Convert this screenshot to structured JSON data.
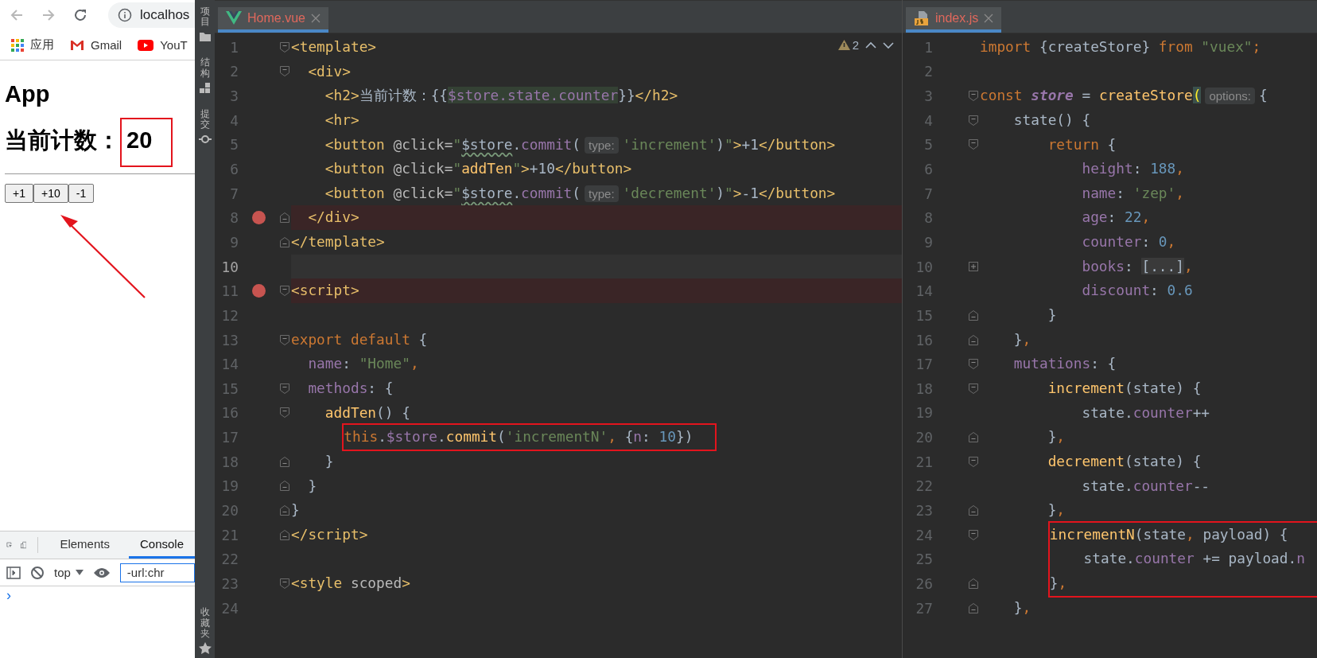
{
  "browser": {
    "address": "localhos",
    "bookmarks": [
      {
        "label": "应用"
      },
      {
        "label": "Gmail"
      },
      {
        "label": "YouT"
      }
    ],
    "page": {
      "title": "App",
      "counter_label": "当前计数：",
      "counter_value": "20",
      "counter_boxed": true,
      "buttons": [
        "+1",
        "+10",
        "-1"
      ],
      "arrow": true
    },
    "devtools": {
      "tabs": [
        {
          "label": "Elements",
          "selected": false
        },
        {
          "label": "Console",
          "selected": true
        }
      ],
      "context": "top",
      "filter": "-url:chr",
      "prompt": "›"
    }
  },
  "tool_strip": {
    "top_items": [
      {
        "label": "项目"
      },
      {
        "label": "结构"
      },
      {
        "label": "提交"
      }
    ],
    "bottom_items": [
      {
        "label": "收藏夹"
      }
    ]
  },
  "editors": [
    {
      "tab": {
        "label": "Home.vue",
        "kind": "vue",
        "selected": true
      },
      "warnings": "2",
      "lines": [
        {
          "number": "1",
          "fold": {
            "kind": "open"
          },
          "breakpoint": false,
          "current": false,
          "boxed": false,
          "tokens": [
            {
              "text": "<template>",
              "kind": "tag"
            }
          ]
        },
        {
          "number": "2",
          "fold": {
            "kind": "open"
          },
          "breakpoint": false,
          "current": false,
          "boxed": false,
          "tokens": [
            {
              "text": "  <div>",
              "kind": "tag"
            }
          ]
        },
        {
          "number": "3",
          "breakpoint": false,
          "current": false,
          "boxed": false,
          "tokens": [
            {
              "text": "    <h2>",
              "kind": "tag"
            },
            {
              "text": "当前计数：{{",
              "kind": "plain"
            },
            {
              "text": "$store.state.counter",
              "kind": "interp"
            },
            {
              "text": "}}",
              "kind": "plain"
            },
            {
              "text": "</h2>",
              "kind": "tag"
            }
          ]
        },
        {
          "number": "4",
          "breakpoint": false,
          "current": false,
          "boxed": false,
          "tokens": [
            {
              "text": "    <hr>",
              "kind": "tag"
            }
          ]
        },
        {
          "number": "5",
          "breakpoint": false,
          "current": false,
          "boxed": false,
          "tokens": [
            {
              "text": "    <button",
              "kind": "tag"
            },
            {
              "text": " @click=",
              "kind": "attr"
            },
            {
              "text": "\"",
              "kind": "string"
            },
            {
              "text": "$store",
              "kind": "warn"
            },
            {
              "text": ".",
              "kind": "plain"
            },
            {
              "text": "commit",
              "kind": "prop"
            },
            {
              "text": "(",
              "kind": "plain"
            },
            {
              "text": "type:",
              "kind": "hint"
            },
            {
              "text": "'increment'",
              "kind": "string"
            },
            {
              "text": ")",
              "kind": "plain"
            },
            {
              "text": "\"",
              "kind": "string"
            },
            {
              "text": ">",
              "kind": "tag"
            },
            {
              "text": "+1",
              "kind": "plain"
            },
            {
              "text": "</button>",
              "kind": "tag"
            }
          ]
        },
        {
          "number": "6",
          "breakpoint": false,
          "current": false,
          "boxed": false,
          "tokens": [
            {
              "text": "    <button",
              "kind": "tag"
            },
            {
              "text": " @click=",
              "kind": "attr"
            },
            {
              "text": "\"",
              "kind": "string"
            },
            {
              "text": "addTen",
              "kind": "fn"
            },
            {
              "text": "\"",
              "kind": "string"
            },
            {
              "text": ">",
              "kind": "tag"
            },
            {
              "text": "+10",
              "kind": "plain"
            },
            {
              "text": "</button>",
              "kind": "tag"
            }
          ]
        },
        {
          "number": "7",
          "breakpoint": false,
          "current": false,
          "boxed": false,
          "tokens": [
            {
              "text": "    <button",
              "kind": "tag"
            },
            {
              "text": " @click=",
              "kind": "attr"
            },
            {
              "text": "\"",
              "kind": "string"
            },
            {
              "text": "$store",
              "kind": "warn"
            },
            {
              "text": ".",
              "kind": "plain"
            },
            {
              "text": "commit",
              "kind": "prop"
            },
            {
              "text": "(",
              "kind": "plain"
            },
            {
              "text": "type:",
              "kind": "hint"
            },
            {
              "text": "'decrement'",
              "kind": "string"
            },
            {
              "text": ")",
              "kind": "plain"
            },
            {
              "text": "\"",
              "kind": "string"
            },
            {
              "text": ">",
              "kind": "tag"
            },
            {
              "text": "-1",
              "kind": "plain"
            },
            {
              "text": "</button>",
              "kind": "tag"
            }
          ]
        },
        {
          "number": "8",
          "fold": {
            "kind": "close"
          },
          "breakpoint": true,
          "current": false,
          "boxed": false,
          "tokens": [
            {
              "text": "  </div>",
              "kind": "tag"
            }
          ]
        },
        {
          "number": "9",
          "fold": {
            "kind": "close"
          },
          "breakpoint": false,
          "current": false,
          "boxed": false,
          "tokens": [
            {
              "text": "</template>",
              "kind": "tag"
            }
          ]
        },
        {
          "number": "10",
          "breakpoint": false,
          "current": true,
          "boxed": false
        },
        {
          "number": "11",
          "fold": {
            "kind": "open"
          },
          "breakpoint": true,
          "current": false,
          "boxed": false,
          "tokens": [
            {
              "text": "<script>",
              "kind": "tag"
            }
          ]
        },
        {
          "number": "12",
          "breakpoint": false,
          "current": false,
          "boxed": false
        },
        {
          "number": "13",
          "fold": {
            "kind": "open"
          },
          "breakpoint": false,
          "current": false,
          "boxed": false,
          "tokens": [
            {
              "text": "export default",
              "kind": "keyword"
            },
            {
              "text": " {",
              "kind": "plain"
            }
          ]
        },
        {
          "number": "14",
          "breakpoint": false,
          "current": false,
          "boxed": false,
          "tokens": [
            {
              "text": "  name",
              "kind": "prop"
            },
            {
              "text": ": ",
              "kind": "plain"
            },
            {
              "text": "\"Home\"",
              "kind": "string"
            },
            {
              "text": ",",
              "kind": "keyword"
            }
          ]
        },
        {
          "number": "15",
          "fold": {
            "kind": "open"
          },
          "breakpoint": false,
          "current": false,
          "boxed": false,
          "tokens": [
            {
              "text": "  methods",
              "kind": "prop"
            },
            {
              "text": ": {",
              "kind": "plain"
            }
          ]
        },
        {
          "number": "16",
          "fold": {
            "kind": "open"
          },
          "breakpoint": false,
          "current": false,
          "boxed": false,
          "tokens": [
            {
              "text": "    addTen",
              "kind": "fn"
            },
            {
              "text": "() {",
              "kind": "plain"
            }
          ]
        },
        {
          "number": "17",
          "breakpoint": false,
          "current": false,
          "boxed": true,
          "tokens": [
            {
              "text": "      this",
              "kind": "keyword"
            },
            {
              "text": ".",
              "kind": "plain"
            },
            {
              "text": "$store",
              "kind": "prop"
            },
            {
              "text": ".",
              "kind": "plain"
            },
            {
              "text": "commit",
              "kind": "fn"
            },
            {
              "text": "(",
              "kind": "plain"
            },
            {
              "text": "'incrementN'",
              "kind": "string"
            },
            {
              "text": ",",
              "kind": "keyword"
            },
            {
              "text": " {",
              "kind": "plain"
            },
            {
              "text": "n",
              "kind": "prop"
            },
            {
              "text": ": ",
              "kind": "plain"
            },
            {
              "text": "10",
              "kind": "number"
            },
            {
              "text": "})",
              "kind": "plain"
            }
          ]
        },
        {
          "number": "18",
          "fold": {
            "kind": "close"
          },
          "breakpoint": false,
          "current": false,
          "boxed": false,
          "tokens": [
            {
              "text": "    }",
              "kind": "plain"
            }
          ]
        },
        {
          "number": "19",
          "fold": {
            "kind": "close"
          },
          "breakpoint": false,
          "current": false,
          "boxed": false,
          "tokens": [
            {
              "text": "  }",
              "kind": "plain"
            }
          ]
        },
        {
          "number": "20",
          "fold": {
            "kind": "close"
          },
          "breakpoint": false,
          "current": false,
          "boxed": false,
          "tokens": [
            {
              "text": "}",
              "kind": "plain"
            }
          ]
        },
        {
          "number": "21",
          "fold": {
            "kind": "close"
          },
          "breakpoint": false,
          "current": false,
          "boxed": false,
          "tokens": [
            {
              "text": "</script>",
              "kind": "tag"
            }
          ]
        },
        {
          "number": "22",
          "breakpoint": false,
          "current": false,
          "boxed": false
        },
        {
          "number": "23",
          "fold": {
            "kind": "open"
          },
          "breakpoint": false,
          "current": false,
          "boxed": false,
          "tokens": [
            {
              "text": "<style",
              "kind": "tag"
            },
            {
              "text": " scoped",
              "kind": "attr"
            },
            {
              "text": ">",
              "kind": "tag"
            }
          ]
        },
        {
          "number": "24",
          "breakpoint": false,
          "current": false,
          "boxed": false
        }
      ]
    },
    {
      "tab": {
        "label": "index.js",
        "kind": "js",
        "selected": true
      },
      "lines": [
        {
          "number": "1",
          "breakpoint": false,
          "current": false,
          "boxed": false,
          "tokens": [
            {
              "text": "import ",
              "kind": "keyword"
            },
            {
              "text": "{createStore} ",
              "kind": "plain"
            },
            {
              "text": "from ",
              "kind": "keyword"
            },
            {
              "text": "\"vuex\"",
              "kind": "string"
            },
            {
              "text": ";",
              "kind": "keyword"
            }
          ]
        },
        {
          "number": "2",
          "breakpoint": false,
          "current": false,
          "boxed": false
        },
        {
          "number": "3",
          "fold": {
            "kind": "open"
          },
          "breakpoint": false,
          "current": false,
          "boxed": false,
          "tokens": [
            {
              "text": "const ",
              "kind": "keyword"
            },
            {
              "text": "store",
              "kind": "var"
            },
            {
              "text": " = ",
              "kind": "plain"
            },
            {
              "text": "createStore",
              "kind": "fn"
            },
            {
              "text": "(",
              "kind": "paren"
            },
            {
              "text": "options:",
              "kind": "hint"
            },
            {
              "text": "{",
              "kind": "plain"
            }
          ]
        },
        {
          "number": "4",
          "fold": {
            "kind": "open"
          },
          "breakpoint": false,
          "current": false,
          "boxed": false,
          "tokens": [
            {
              "text": "    state() {",
              "kind": "plain"
            }
          ]
        },
        {
          "number": "5",
          "fold": {
            "kind": "open"
          },
          "breakpoint": false,
          "current": false,
          "boxed": false,
          "tokens": [
            {
              "text": "        return",
              "kind": "keyword"
            },
            {
              "text": " {",
              "kind": "plain"
            }
          ]
        },
        {
          "number": "6",
          "breakpoint": false,
          "current": false,
          "boxed": false,
          "tokens": [
            {
              "text": "            height",
              "kind": "prop"
            },
            {
              "text": ": ",
              "kind": "plain"
            },
            {
              "text": "188",
              "kind": "number"
            },
            {
              "text": ",",
              "kind": "keyword"
            }
          ]
        },
        {
          "number": "7",
          "breakpoint": false,
          "current": false,
          "boxed": false,
          "tokens": [
            {
              "text": "            name",
              "kind": "prop"
            },
            {
              "text": ": ",
              "kind": "plain"
            },
            {
              "text": "'zep'",
              "kind": "string"
            },
            {
              "text": ",",
              "kind": "keyword"
            }
          ]
        },
        {
          "number": "8",
          "breakpoint": false,
          "current": false,
          "boxed": false,
          "tokens": [
            {
              "text": "            age",
              "kind": "prop"
            },
            {
              "text": ": ",
              "kind": "plain"
            },
            {
              "text": "22",
              "kind": "number"
            },
            {
              "text": ",",
              "kind": "keyword"
            }
          ]
        },
        {
          "number": "9",
          "breakpoint": false,
          "current": false,
          "boxed": false,
          "tokens": [
            {
              "text": "            counter",
              "kind": "prop"
            },
            {
              "text": ": ",
              "kind": "plain"
            },
            {
              "text": "0",
              "kind": "number"
            },
            {
              "text": ",",
              "kind": "keyword"
            }
          ]
        },
        {
          "number": "10",
          "fold": {
            "kind": "expand"
          },
          "breakpoint": false,
          "current": false,
          "boxed": false,
          "tokens": [
            {
              "text": "            books",
              "kind": "prop"
            },
            {
              "text": ": ",
              "kind": "plain"
            },
            {
              "text": "[...]",
              "kind": "folded"
            },
            {
              "text": ",",
              "kind": "keyword"
            }
          ]
        },
        {
          "number": "14",
          "breakpoint": false,
          "current": false,
          "boxed": false,
          "tokens": [
            {
              "text": "            discount",
              "kind": "prop"
            },
            {
              "text": ": ",
              "kind": "plain"
            },
            {
              "text": "0.6",
              "kind": "number"
            }
          ]
        },
        {
          "number": "15",
          "fold": {
            "kind": "close"
          },
          "breakpoint": false,
          "current": false,
          "boxed": false,
          "tokens": [
            {
              "text": "        }",
              "kind": "plain"
            }
          ]
        },
        {
          "number": "16",
          "fold": {
            "kind": "close"
          },
          "breakpoint": false,
          "current": false,
          "boxed": false,
          "tokens": [
            {
              "text": "    }",
              "kind": "plain"
            },
            {
              "text": ",",
              "kind": "keyword"
            }
          ]
        },
        {
          "number": "17",
          "fold": {
            "kind": "open"
          },
          "breakpoint": false,
          "current": false,
          "boxed": false,
          "tokens": [
            {
              "text": "    mutations",
              "kind": "prop"
            },
            {
              "text": ": {",
              "kind": "plain"
            }
          ]
        },
        {
          "number": "18",
          "fold": {
            "kind": "open"
          },
          "breakpoint": false,
          "current": false,
          "boxed": false,
          "tokens": [
            {
              "text": "        increment",
              "kind": "fn"
            },
            {
              "text": "(state) {",
              "kind": "plain"
            }
          ]
        },
        {
          "number": "19",
          "breakpoint": false,
          "current": false,
          "boxed": false,
          "tokens": [
            {
              "text": "            state.",
              "kind": "plain"
            },
            {
              "text": "counter",
              "kind": "prop"
            },
            {
              "text": "++",
              "kind": "plain"
            }
          ]
        },
        {
          "number": "20",
          "fold": {
            "kind": "close"
          },
          "breakpoint": false,
          "current": false,
          "boxed": false,
          "tokens": [
            {
              "text": "        }",
              "kind": "plain"
            },
            {
              "text": ",",
              "kind": "keyword"
            }
          ]
        },
        {
          "number": "21",
          "fold": {
            "kind": "open"
          },
          "breakpoint": false,
          "current": false,
          "boxed": false,
          "tokens": [
            {
              "text": "        decrement",
              "kind": "fn"
            },
            {
              "text": "(state) {",
              "kind": "plain"
            }
          ]
        },
        {
          "number": "22",
          "breakpoint": false,
          "current": false,
          "boxed": false,
          "tokens": [
            {
              "text": "            state.",
              "kind": "plain"
            },
            {
              "text": "counter",
              "kind": "prop"
            },
            {
              "text": "--",
              "kind": "plain"
            }
          ]
        },
        {
          "number": "23",
          "fold": {
            "kind": "close"
          },
          "breakpoint": false,
          "current": false,
          "boxed": false,
          "tokens": [
            {
              "text": "        }",
              "kind": "plain"
            },
            {
              "text": ",",
              "kind": "keyword"
            }
          ]
        },
        {
          "number": "24",
          "fold": {
            "kind": "open"
          },
          "breakpoint": false,
          "current": false,
          "boxed": true,
          "tokens": [
            {
              "text": "        incrementN",
              "kind": "fn"
            },
            {
              "text": "(state",
              "kind": "plain"
            },
            {
              "text": ",",
              "kind": "keyword"
            },
            {
              "text": " payload) {",
              "kind": "plain"
            }
          ]
        },
        {
          "number": "25",
          "breakpoint": false,
          "current": false,
          "boxed": true,
          "tokens": [
            {
              "text": "            state.",
              "kind": "plain"
            },
            {
              "text": "counter",
              "kind": "prop"
            },
            {
              "text": " += payload.",
              "kind": "plain"
            },
            {
              "text": "n",
              "kind": "prop"
            }
          ]
        },
        {
          "number": "26",
          "fold": {
            "kind": "close"
          },
          "breakpoint": false,
          "current": false,
          "boxed": true,
          "tokens": [
            {
              "text": "        }",
              "kind": "plain"
            },
            {
              "text": ",",
              "kind": "keyword"
            }
          ]
        },
        {
          "number": "27",
          "fold": {
            "kind": "close"
          },
          "breakpoint": false,
          "current": false,
          "boxed": false,
          "tokens": [
            {
              "text": "    }",
              "kind": "plain"
            },
            {
              "text": ",",
              "kind": "keyword"
            }
          ]
        }
      ]
    }
  ]
}
